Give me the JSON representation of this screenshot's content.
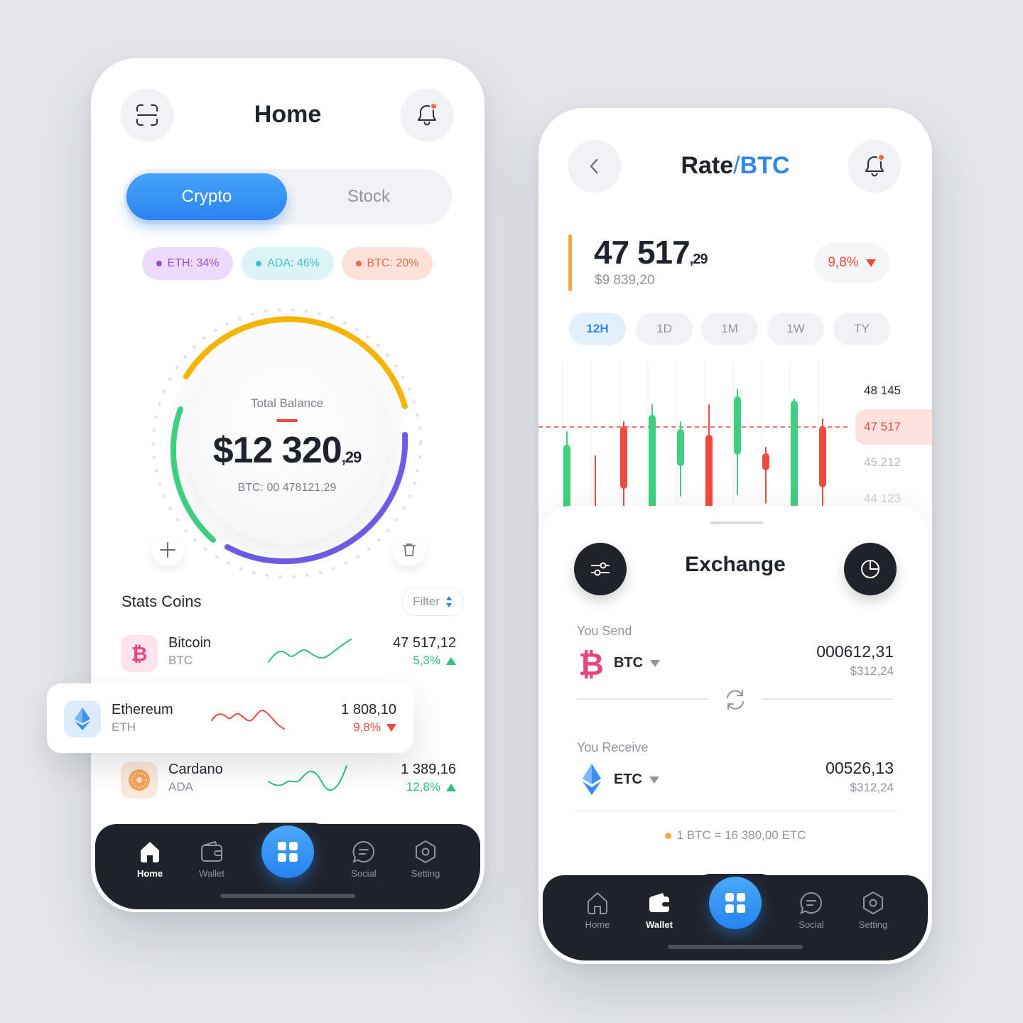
{
  "home": {
    "title": "Home",
    "segments": {
      "active": "Crypto",
      "inactive": "Stock"
    },
    "allocation_pills": [
      {
        "label": "ETH: 34%",
        "color": "#9b4fd9",
        "bg": "#ecdbfb"
      },
      {
        "label": "ADA: 46%",
        "color": "#3bc3cf",
        "bg": "#dcf4f6"
      },
      {
        "label": "BTC: 20%",
        "color": "#ee6a4a",
        "bg": "#fde2da"
      }
    ],
    "balance": {
      "label": "Total Balance",
      "amount": "$12 320",
      "cents": ",29",
      "btc": "BTC: 00 478121,29",
      "ring_colors": [
        "#f4b400",
        "#6c5ce7",
        "#3ecf80"
      ]
    },
    "stats_title": "Stats Coins",
    "filter_label": "Filter",
    "coins": [
      {
        "name": "Bitcoin",
        "symbol": "BTC",
        "value": "47 517,12",
        "change": "5,3%",
        "direction": "up",
        "icon": "bitcoin-icon"
      },
      {
        "name": "Ethereum",
        "symbol": "ETH",
        "value": "1 808,10",
        "change": "9,8%",
        "direction": "down",
        "icon": "ethereum-icon"
      },
      {
        "name": "Cardano",
        "symbol": "ADA",
        "value": "1 389,16",
        "change": "12,8%",
        "direction": "up",
        "icon": "cardano-icon"
      }
    ],
    "tabbar": {
      "home": "Home",
      "wallet": "Wallet",
      "social": "Social",
      "setting": "Setting",
      "active": "Home"
    }
  },
  "rate": {
    "title_main": "Rate",
    "title_sep": "/",
    "title_pair": "BTC",
    "price_main": "47 517",
    "price_cents": ",29",
    "price_usd": "$9 839,20",
    "change": "9,8%",
    "ranges": [
      "12H",
      "1D",
      "1M",
      "1W",
      "TY"
    ],
    "active_range": "12H",
    "y_ticks": [
      "48 145",
      "47 517",
      "45.212",
      "44 123"
    ],
    "exchange": {
      "title": "Exchange",
      "send_label": "You Send",
      "send_currency": "BTC",
      "send_amount": "000612,31",
      "send_usd": "$312,24",
      "receive_label": "You Receive",
      "receive_currency": "ETC",
      "receive_amount": "00526,13",
      "receive_usd": "$312,24",
      "rate_note": "1 BTC = 16 380,00 ETC"
    },
    "tabbar": {
      "home": "Home",
      "wallet": "Wallet",
      "social": "Social",
      "setting": "Setting",
      "active": "Wallet"
    }
  },
  "colors": {
    "accent_blue": "#2f86ee",
    "up_green": "#2ec27e",
    "down_red": "#ef4a3f",
    "dark": "#1f2329"
  }
}
